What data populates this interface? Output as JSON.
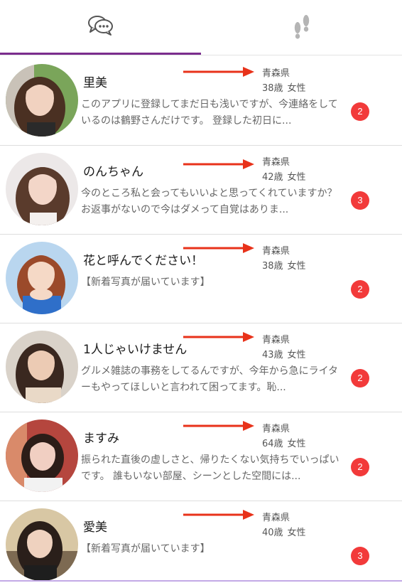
{
  "tabs": [
    {
      "id": "messages",
      "icon": "chat-bubbles-icon",
      "active": true
    },
    {
      "id": "footprints",
      "icon": "footprints-icon",
      "active": false
    }
  ],
  "colors": {
    "accent": "#7b2d8e",
    "badge": "#f23a3a",
    "arrow": "#e8321a"
  },
  "rows": [
    {
      "name": "里美",
      "prefecture": "青森県",
      "age": "38歳",
      "gender": "女性",
      "message": "このアプリに登録してまだ日も浅いですが、今連絡をしているのは鶴野さんだけです。 登録した初日に...",
      "unread": "2"
    },
    {
      "name": "のんちゃん",
      "prefecture": "青森県",
      "age": "42歳",
      "gender": "女性",
      "message": "今のところ私と会ってもいいよと思ってくれていますか？ お返事がないので今はダメって自覚はありま...",
      "unread": "3"
    },
    {
      "name": "花と呼んでください！",
      "prefecture": "青森県",
      "age": "38歳",
      "gender": "女性",
      "message": "【新着写真が届いています】",
      "unread": "2"
    },
    {
      "name": "1人じゃいけません",
      "prefecture": "青森県",
      "age": "43歳",
      "gender": "女性",
      "message": "グルメ雑誌の事務をしてるんですが、今年から急にライターもやってほしいと言われて困ってます。恥...",
      "unread": "2"
    },
    {
      "name": "ますみ",
      "prefecture": "青森県",
      "age": "64歳",
      "gender": "女性",
      "message": "振られた直後の虚しさと、帰りたくない気持ちでいっぱいです。 誰もいない部屋、シーンとした空間には...",
      "unread": "2"
    },
    {
      "name": "愛美",
      "prefecture": "青森県",
      "age": "40歳",
      "gender": "女性",
      "message": "【新着写真が届いています】",
      "unread": "3"
    }
  ]
}
